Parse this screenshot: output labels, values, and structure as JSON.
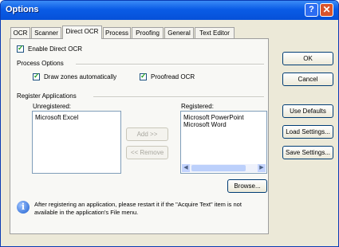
{
  "window": {
    "title": "Options",
    "help_glyph": "?",
    "close_glyph": "✕"
  },
  "tabs": [
    {
      "label": "OCR"
    },
    {
      "label": "Scanner"
    },
    {
      "label": "Direct OCR",
      "active": true
    },
    {
      "label": "Process"
    },
    {
      "label": "Proofing"
    },
    {
      "label": "General"
    },
    {
      "label": "Text Editor"
    }
  ],
  "direct_ocr": {
    "enable_label": "Enable Direct OCR",
    "enable_checked": true,
    "process_options_label": "Process Options",
    "draw_zones_label": "Draw zones automatically",
    "draw_zones_checked": true,
    "proofread_label": "Proofread OCR",
    "proofread_checked": true,
    "register_label": "Register Applications",
    "unregistered_label": "Unregistered:",
    "unregistered_items": [
      "Microsoft Excel"
    ],
    "registered_label": "Registered:",
    "registered_items": [
      "Microsoft PowerPoint",
      "Microsoft Word"
    ],
    "add_label": "Add >>",
    "remove_label": "<< Remove",
    "browse_label": "Browse...",
    "info_text": "After registering an application, please restart it if the \"Acquire Text\" item is not available in the application's File menu."
  },
  "side_buttons": {
    "ok": "OK",
    "cancel": "Cancel",
    "use_defaults": "Use Defaults",
    "load_settings": "Load Settings...",
    "save_settings": "Save Settings..."
  },
  "colors": {
    "titlebar": "#0a5ce6",
    "dialog_bg": "#ece9d8",
    "panel_bg": "#f8f8f5",
    "check": "#21a121"
  }
}
